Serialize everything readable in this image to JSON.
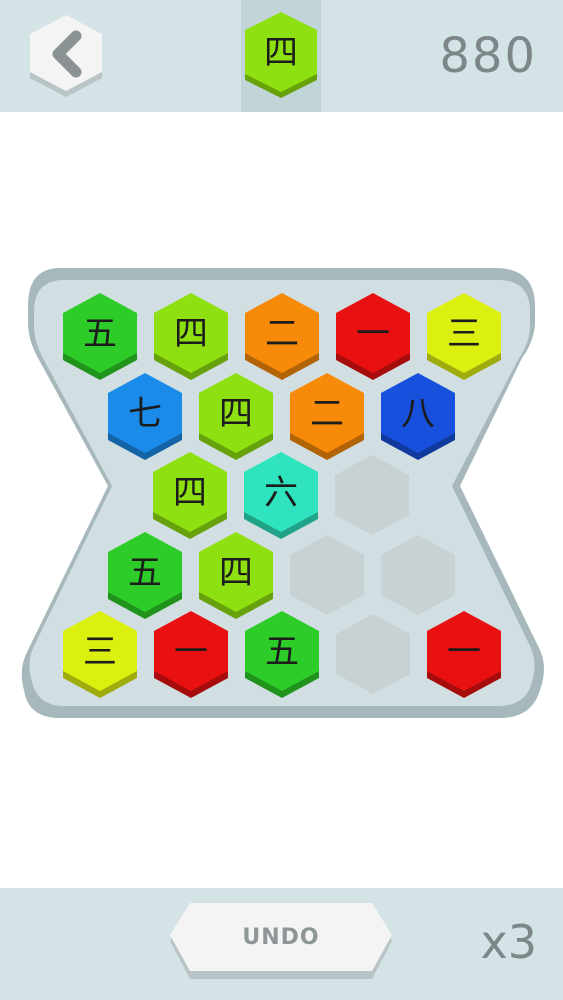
{
  "header": {
    "back_icon": "chevron-left-icon",
    "next_tile": {
      "char": "四",
      "color": "#8fe010"
    },
    "score": "880"
  },
  "footer": {
    "undo_label": "UNDO",
    "undo_count": "x3"
  },
  "colors": {
    "一": "#e81010",
    "二": "#f78a08",
    "三": "#dcf010",
    "四": "#8fe010",
    "五": "#2dcc28",
    "六": "#2ee3bd",
    "七": "#1a8be8",
    "八": "#1650dc",
    "empty": "#c8d2d4",
    "tray": "#d1dfe2",
    "tray_shadow": "#a6b8bc"
  },
  "board": {
    "rows": [
      [
        "五",
        "四",
        "二",
        "一",
        "三"
      ],
      [
        "七",
        "四",
        "二",
        "八"
      ],
      [
        "四",
        "六",
        ""
      ],
      [
        "五",
        "四",
        "",
        ""
      ],
      [
        "三",
        "一",
        "五",
        "",
        "一"
      ]
    ]
  }
}
